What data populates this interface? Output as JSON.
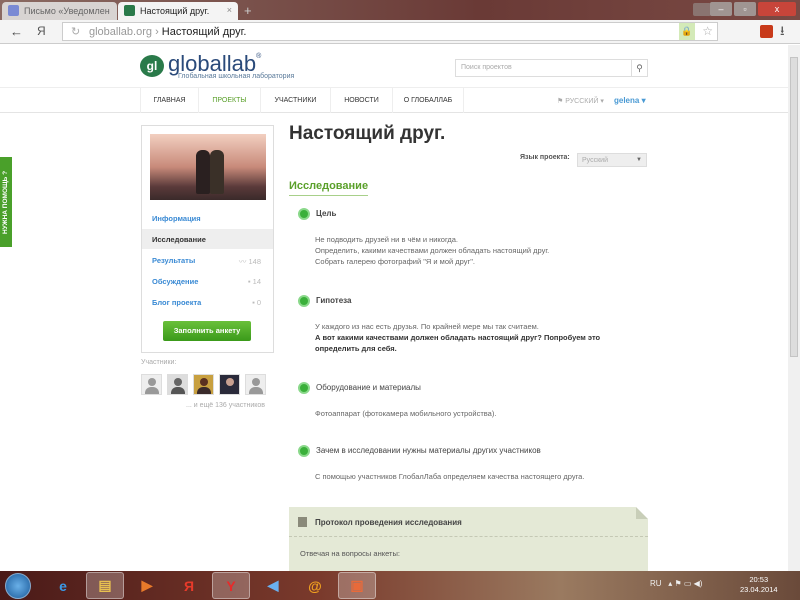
{
  "browser": {
    "tabs": [
      {
        "label": "Письмо «Уведомлен"
      },
      {
        "label": "Настоящий друг."
      }
    ],
    "close": "×",
    "new_tab": "+",
    "back": "←",
    "ya": "Я",
    "reload": "↻",
    "url_domain": "globallab.org",
    "url_sep": "›",
    "url_page": "Настоящий друг.",
    "lock": "🔒",
    "star": "☆",
    "download": "⭳",
    "minimize": "–",
    "maximize": "▫",
    "close_window": "x"
  },
  "site": {
    "logo_mark": "gl",
    "logo_name": "globallab",
    "logo_reg": "®",
    "logo_sub": "Глобальная школьная лаборатория",
    "search_placeholder": "Поиск проектов",
    "search_icon": "⚲",
    "nav": [
      "ГЛАВНАЯ",
      "ПРОЕКТЫ",
      "УЧАСТНИКИ",
      "НОВОСТИ",
      "О ГЛОБАЛЛАБ"
    ],
    "language": "⚑ РУССКИЙ ▾",
    "user": "gelena ▾",
    "help": "НУЖНА ПОМОЩЬ ?"
  },
  "sidebar": {
    "items": [
      {
        "label": "Информация"
      },
      {
        "label": "Исследование"
      },
      {
        "label": "Результаты",
        "count": "〰 148"
      },
      {
        "label": "Обсуждение",
        "count": "▪ 14"
      },
      {
        "label": "Блог проекта",
        "count": "▪ 0"
      }
    ],
    "button": "Заполнить анкету",
    "participants_label": "Участники:",
    "more": "... и ещё 136 участников"
  },
  "main": {
    "title": "Настоящий друг.",
    "lang_label": "Язык проекта:",
    "lang_value": "Русский",
    "lang_arrow": "▼",
    "section": "Исследование",
    "blocks": [
      {
        "title": "Цель",
        "lines": [
          "Не подводить друзей ни в чём и никогда.",
          "Определить, какими качествами должен обладать настоящий друг.",
          "Собрать галерею фотографий \"Я и мой друг\"."
        ]
      },
      {
        "title": "Гипотеза",
        "lines": [
          "У каждого из нас есть друзья. По крайней мере мы так считаем."
        ],
        "bold": "А вот какими качествами должен обладать настоящий друг? Попробуем это определить для себя."
      },
      {
        "title": "Оборудование и материалы",
        "lines": [
          "Фотоаппарат (фотокамера мобильного устройства)."
        ]
      },
      {
        "title": "Зачем в исследовании нужны материалы других участников",
        "lines": [
          "С помощью участников ГлобалЛаба определяем качества настоящего друга."
        ]
      }
    ],
    "protocol_title": "Протокол проведения исследования",
    "protocol_text": "Отвечая на вопросы анкеты:"
  },
  "taskbar": {
    "apps": [
      "e",
      "▤",
      "▶",
      "Я",
      "Y",
      "◀",
      "@",
      "▣"
    ],
    "lang": "RU",
    "tray": "▴ ⚑ ▭ ◀)",
    "time": "20:53",
    "date": "23.04.2014"
  },
  "colors": {
    "accent": "#5aa02a",
    "link": "#3a8ad4"
  }
}
